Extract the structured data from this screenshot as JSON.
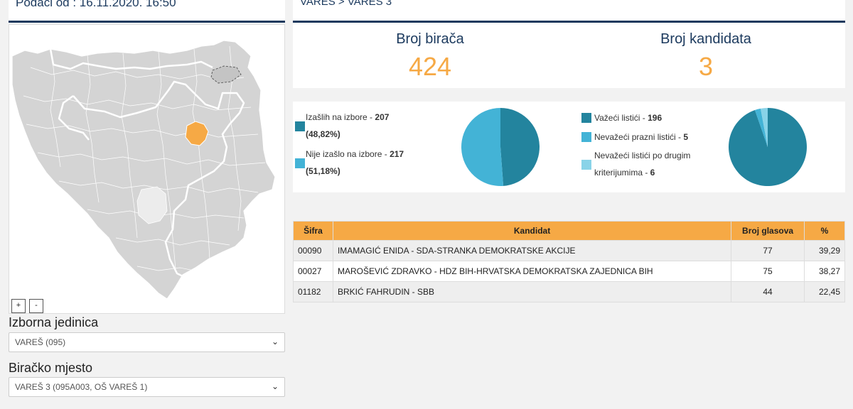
{
  "header": {
    "timestamp": "Podaci od : 16.11.2020. 16:50"
  },
  "breadcrumb": "VAREŠ > VAREŠ 3",
  "map": {
    "zoom_in": "+",
    "zoom_out": "-",
    "highlight_color": "#f6a945",
    "base_color": "#d4d4d4"
  },
  "selectors": {
    "unit_label": "Izborna jedinica",
    "unit_value": "VAREŠ (095)",
    "station_label": "Biračko mjesto",
    "station_value": "VAREŠ 3 (095A003, OŠ VAREŠ 1)"
  },
  "stats": {
    "voters_label": "Broj birača",
    "voters_value": "424",
    "candidates_label": "Broj kandidata",
    "candidates_value": "3"
  },
  "turnout": {
    "voted_label": "Izašlih na izbore - ",
    "voted_count": "207",
    "voted_pct": "(48,82%)",
    "not_voted_label": "Nije izašlo na izbore - ",
    "not_voted_count": "217",
    "not_voted_pct": "(51,18%)"
  },
  "ballots": {
    "valid_label": "Važeći listići - ",
    "valid_count": "196",
    "empty_label": "Nevažeći prazni listići - ",
    "empty_count": "5",
    "other_label_1": "Nevažeći listići po drugim",
    "other_label_2": "kriterijumima - ",
    "other_count": "6"
  },
  "colors": {
    "dark_teal": "#23849e",
    "light_blue": "#43b3d6",
    "pale_blue": "#89d3e8",
    "accent": "#f6a945",
    "navy": "#1c3a5e"
  },
  "table": {
    "headers": {
      "code": "Šifra",
      "candidate": "Kandidat",
      "votes": "Broj glasova",
      "pct": "%"
    },
    "rows": [
      {
        "code": "00090",
        "candidate": "IMAMAGIĆ ENIDA - SDA-STRANKA DEMOKRATSKE AKCIJE",
        "votes": "77",
        "pct": "39,29"
      },
      {
        "code": "00027",
        "candidate": "MAROŠEVIĆ ZDRAVKO - HDZ BIH-HRVATSKA DEMOKRATSKA ZAJEDNICA BIH",
        "votes": "75",
        "pct": "38,27"
      },
      {
        "code": "01182",
        "candidate": "BRKIĆ FAHRUDIN - SBB",
        "votes": "44",
        "pct": "22,45"
      }
    ]
  }
}
